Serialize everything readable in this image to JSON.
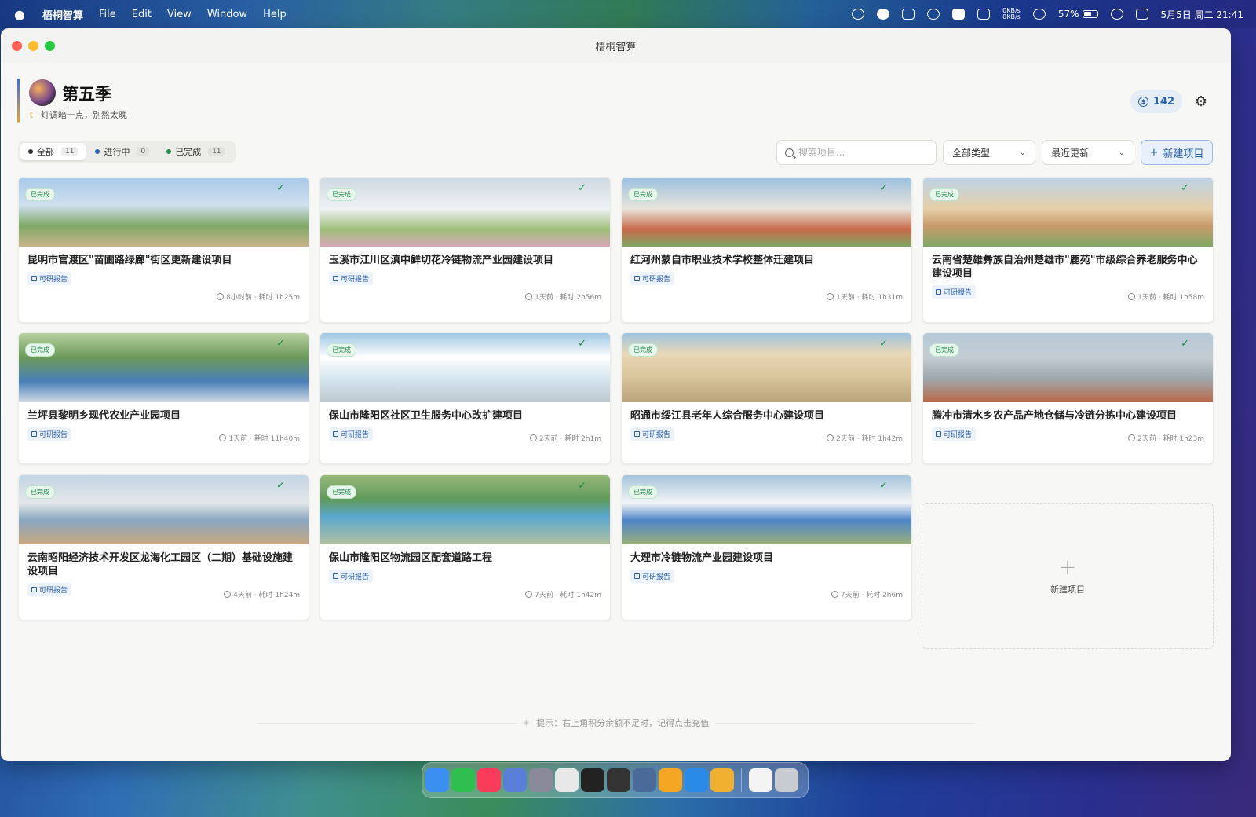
{
  "menubar": {
    "apple": "",
    "app_name": "梧桐智算",
    "menus": [
      "File",
      "Edit",
      "View",
      "Window",
      "Help"
    ],
    "net_up": "0KB/s",
    "net_down": "0KB/s",
    "battery_pct": "57%",
    "battery_level": 0.57,
    "datetime": "5月5日 周二 21:41"
  },
  "window": {
    "title": "梧桐智算"
  },
  "profile": {
    "name": "第五季",
    "subtitle": "灯调暗一点，别熬太晚"
  },
  "credits": {
    "value": "142",
    "icon": "coin-icon"
  },
  "filters": [
    {
      "label": "全部",
      "count": "11",
      "color": "#333333"
    },
    {
      "label": "进行中",
      "count": "0",
      "color": "#2a5fb0"
    },
    {
      "label": "已完成",
      "count": "11",
      "color": "#1f8a4c"
    }
  ],
  "toolbar": {
    "search_placeholder": "搜索项目...",
    "type_filter": "全部类型",
    "sort": "最近更新",
    "new_button": "新建项目"
  },
  "projects": [
    {
      "title": "昆明市官渡区\"苗圃路绿廊\"街区更新建设项目",
      "status": "已完成",
      "tag": "可研报告",
      "meta": "8小时前 · 耗时 1h25m"
    },
    {
      "title": "玉溪市江川区滇中鲜切花冷链物流产业园建设项目",
      "status": "已完成",
      "tag": "可研报告",
      "meta": "1天前 · 耗时 2h56m"
    },
    {
      "title": "红河州蒙自市职业技术学校整体迁建项目",
      "status": "已完成",
      "tag": "可研报告",
      "meta": "1天前 · 耗时 1h31m"
    },
    {
      "title": "云南省楚雄彝族自治州楚雄市\"鹿苑\"市级综合养老服务中心建设项目",
      "status": "已完成",
      "tag": "可研报告",
      "meta": "1天前 · 耗时 1h58m"
    },
    {
      "title": "兰坪县黎明乡现代农业产业园项目",
      "status": "已完成",
      "tag": "可研报告",
      "meta": "1天前 · 耗时 11h40m"
    },
    {
      "title": "保山市隆阳区社区卫生服务中心改扩建项目",
      "status": "已完成",
      "tag": "可研报告",
      "meta": "2天前 · 耗时 2h1m"
    },
    {
      "title": "昭通市绥江县老年人综合服务中心建设项目",
      "status": "已完成",
      "tag": "可研报告",
      "meta": "2天前 · 耗时 1h42m"
    },
    {
      "title": "腾冲市清水乡农产品产地仓储与冷链分拣中心建设项目",
      "status": "已完成",
      "tag": "可研报告",
      "meta": "2天前 · 耗时 1h23m"
    },
    {
      "title": "云南昭阳经济技术开发区龙海化工园区（二期）基础设施建设项目",
      "status": "已完成",
      "tag": "可研报告",
      "meta": "4天前 · 耗时 1h24m"
    },
    {
      "title": "保山市隆阳区物流园区配套道路工程",
      "status": "已完成",
      "tag": "可研报告",
      "meta": "7天前 · 耗时 1h42m"
    },
    {
      "title": "大理市冷链物流产业园建设项目",
      "status": "已完成",
      "tag": "可研报告",
      "meta": "7天前 · 耗时 2h6m"
    }
  ],
  "new_card": {
    "label": "新建项目"
  },
  "hint": "提示：右上角积分余额不足时，记得点击充值",
  "dock": {
    "apps": [
      "finder-icon",
      "wechat-icon",
      "music-icon",
      "launchpad-icon",
      "settings-icon",
      "chrome-icon",
      "terminal-icon",
      "editor-icon",
      "disk-icon",
      "pages-icon",
      "browser-icon",
      "app-icon",
      "document-icon",
      "trash-icon"
    ]
  }
}
